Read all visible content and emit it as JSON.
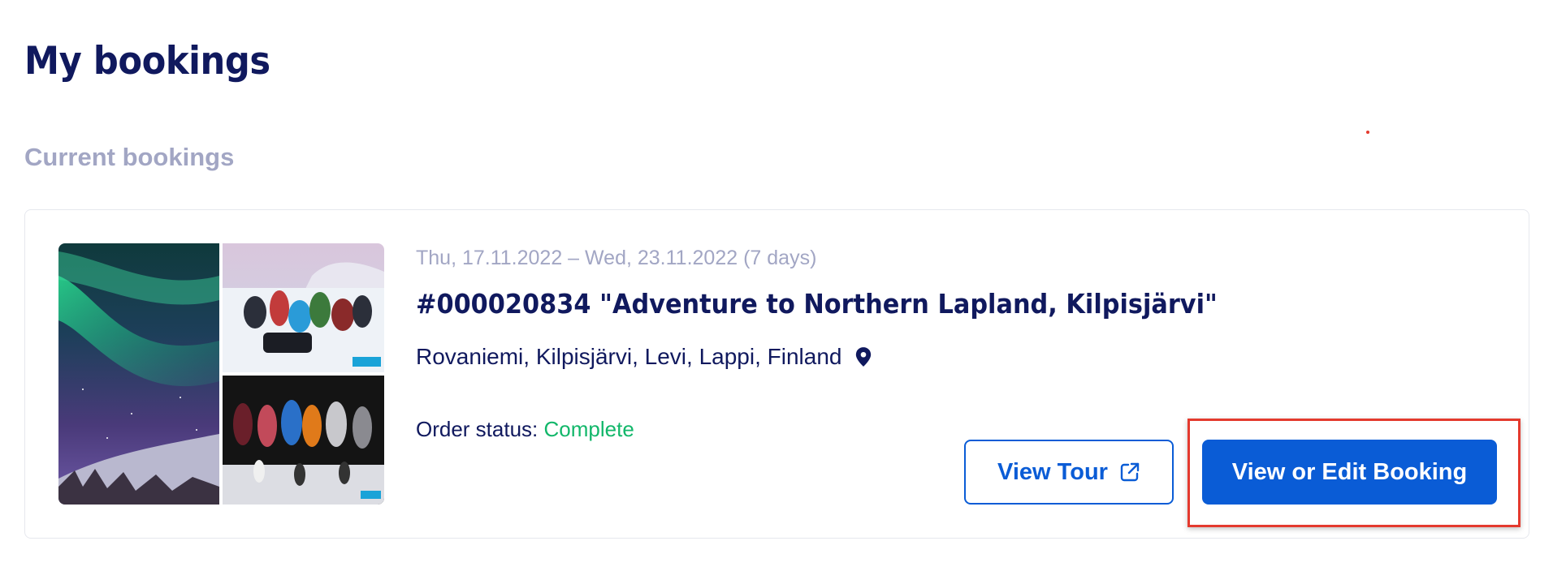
{
  "page": {
    "title": "My bookings",
    "section_title": "Current bookings"
  },
  "booking": {
    "dates": "Thu, 17.11.2022 – Wed, 23.11.2022 (7 days)",
    "title": "#000020834 \"Adventure to Northern Lapland, Kilpisjärvi\"",
    "location": "Rovaniemi, Kilpisjärvi, Levi, Lappi, Finland",
    "location_icon": "map-pin-icon",
    "order_status_label": "Order status:",
    "order_status_value": "Complete",
    "gallery": [
      {
        "name": "aurora-photo",
        "description_icon": "northern-lights"
      },
      {
        "name": "group-snow-photo",
        "description_icon": "group-in-snow"
      },
      {
        "name": "night-snowshoe-photo",
        "description_icon": "group-at-night"
      }
    ]
  },
  "actions": {
    "view_tour_label": "View Tour",
    "view_tour_icon": "external-link-icon",
    "edit_label": "View or Edit Booking"
  },
  "colors": {
    "primary": "#0a5cd6",
    "heading": "#10195e",
    "muted": "#a2a6c4",
    "status_complete": "#12b76a",
    "highlight": "#e43a2e"
  }
}
